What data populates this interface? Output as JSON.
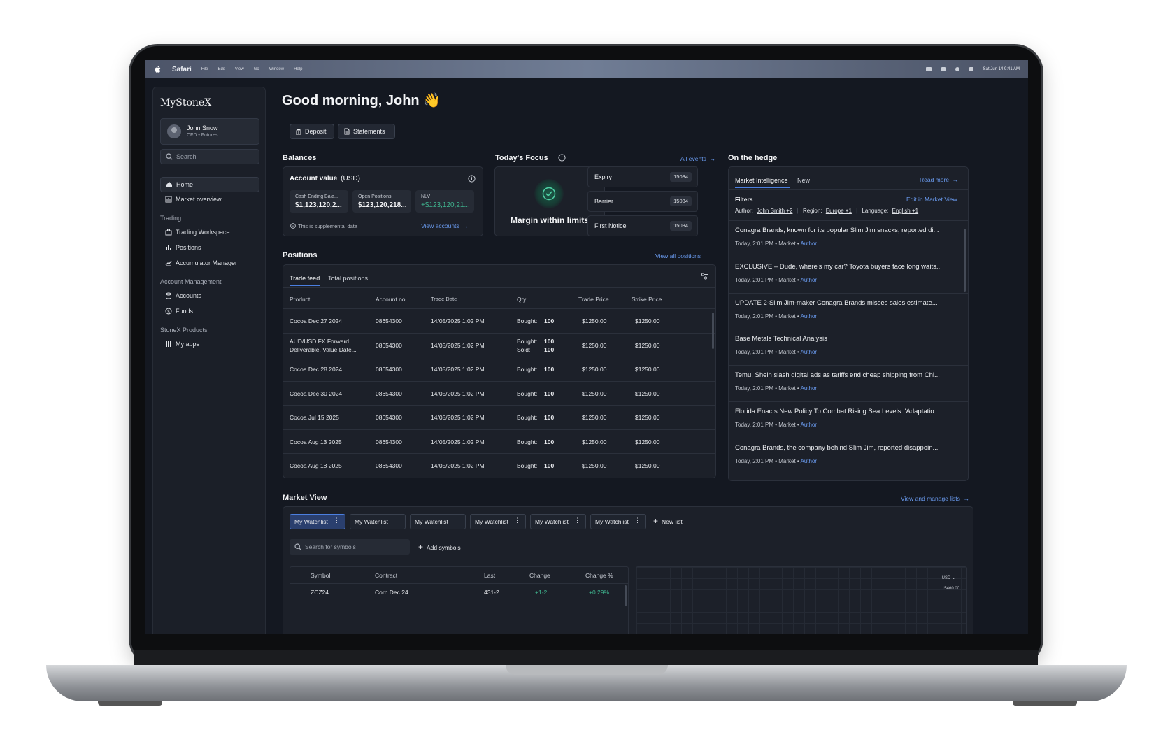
{
  "menubar": {
    "app_name": "Safari",
    "items": [
      "File",
      "Edit",
      "View",
      "Go",
      "Window",
      "Help"
    ],
    "status": "Sat Jun 14  9:41 AM"
  },
  "sidebar": {
    "logo": "MyStoneX",
    "user": {
      "name": "John Snow",
      "subtitle": "CFD • Futures"
    },
    "search_placeholder": "Search",
    "items_top": [
      {
        "label": "Home",
        "icon": "home-icon"
      },
      {
        "label": "Market overview",
        "icon": "chart-icon"
      }
    ],
    "sections": [
      {
        "title": "Trading",
        "items": [
          "Trading Workspace",
          "Positions",
          "Accumulator Manager"
        ]
      },
      {
        "title": "Account Management",
        "items": [
          "Accounts",
          "Funds"
        ]
      },
      {
        "title": "StoneX Products",
        "items": [
          "My apps"
        ]
      }
    ]
  },
  "header": {
    "greeting": "Good morning, John 👋",
    "deposit_label": "Deposit",
    "statements_label": "Statements"
  },
  "balances": {
    "title": "Balances",
    "card_title": "Account value",
    "currency": "(USD)",
    "stats": [
      {
        "label": "Cash Ending Bala...",
        "value": "$1,123,120,2..."
      },
      {
        "label": "Open Positions",
        "value": "$123,120,218..."
      },
      {
        "label": "NLV",
        "value": "+$123,120,21..."
      }
    ],
    "note": "This is supplemental data",
    "view_accounts": "View accounts"
  },
  "focus": {
    "title": "Today's Focus",
    "all_events": "All events",
    "status": "Margin within limits",
    "rows": [
      {
        "label": "Expiry",
        "value": "15034"
      },
      {
        "label": "Barrier",
        "value": "15034"
      },
      {
        "label": "First Notice",
        "value": "15034"
      }
    ]
  },
  "hedge": {
    "title": "On the hedge",
    "tabs": [
      "Market Intelligence",
      "New"
    ],
    "read_more": "Read more",
    "filters_label": "Filters",
    "edit_link": "Edit in Market View",
    "filters": [
      {
        "key": "Author:",
        "value": "John Smith +2"
      },
      {
        "key": "Region:",
        "value": "Europe +1"
      },
      {
        "key": "Language:",
        "value": "English +1"
      }
    ],
    "news": [
      {
        "title": "Conagra Brands, known for its popular Slim Jim snacks, reported di...",
        "meta": "Today, 2:01 PM • Market • ",
        "author": "Author"
      },
      {
        "title": "EXCLUSIVE – Dude, where's my car? Toyota buyers face long waits...",
        "meta": "Today, 2:01 PM • Market • ",
        "author": "Author"
      },
      {
        "title": "UPDATE 2-Slim Jim-maker Conagra Brands misses sales estimate...",
        "meta": "Today, 2:01 PM • Market • ",
        "author": "Author"
      },
      {
        "title": "Base Metals Technical Analysis",
        "meta": "Today, 2:01 PM • Market • ",
        "author": "Author"
      },
      {
        "title": "Temu, Shein slash digital ads as tariffs end cheap shipping from Chi...",
        "meta": "Today, 2:01 PM • Market • ",
        "author": "Author"
      },
      {
        "title": "Florida Enacts New Policy To Combat Rising Sea Levels: 'Adaptatio...",
        "meta": "Today, 2:01 PM • Market • ",
        "author": "Author"
      },
      {
        "title": "Conagra Brands, the company behind Slim Jim, reported disappoin...",
        "meta": "Today, 2:01 PM • Market • ",
        "author": "Author"
      }
    ]
  },
  "positions": {
    "title": "Positions",
    "view_all": "View all positions",
    "tabs": [
      "Trade feed",
      "Total positions"
    ],
    "columns": [
      "Product",
      "Account no.",
      "Trade Date",
      "Qty",
      "Trade Price",
      "Strike Price"
    ],
    "rows": [
      {
        "product": "Cocoa Dec 27 2024",
        "product2": "",
        "account": "08654300",
        "date": "14/05/2025 1:02 PM",
        "qty_label": "Bought:",
        "qty": "100",
        "qty_label2": "",
        "qty2": "",
        "trade_price": "$1250.00",
        "strike_price": "$1250.00"
      },
      {
        "product": "AUD/USD FX Forward",
        "product2": "Deliverable, Value Date...",
        "account": "08654300",
        "date": "14/05/2025 1:02 PM",
        "qty_label": "Bought:",
        "qty": "100",
        "qty_label2": "Sold:",
        "qty2": "100",
        "trade_price": "$1250.00",
        "strike_price": "$1250.00"
      },
      {
        "product": "Cocoa Dec 28 2024",
        "product2": "",
        "account": "08654300",
        "date": "14/05/2025 1:02 PM",
        "qty_label": "Bought:",
        "qty": "100",
        "qty_label2": "",
        "qty2": "",
        "trade_price": "$1250.00",
        "strike_price": "$1250.00"
      },
      {
        "product": "Cocoa Dec 30 2024",
        "product2": "",
        "account": "08654300",
        "date": "14/05/2025 1:02 PM",
        "qty_label": "Bought:",
        "qty": "100",
        "qty_label2": "",
        "qty2": "",
        "trade_price": "$1250.00",
        "strike_price": "$1250.00"
      },
      {
        "product": "Cocoa Jul 15 2025",
        "product2": "",
        "account": "08654300",
        "date": "14/05/2025 1:02 PM",
        "qty_label": "Bought:",
        "qty": "100",
        "qty_label2": "",
        "qty2": "",
        "trade_price": "$1250.00",
        "strike_price": "$1250.00"
      },
      {
        "product": "Cocoa Aug 13 2025",
        "product2": "",
        "account": "08654300",
        "date": "14/05/2025 1:02 PM",
        "qty_label": "Bought:",
        "qty": "100",
        "qty_label2": "",
        "qty2": "",
        "trade_price": "$1250.00",
        "strike_price": "$1250.00"
      },
      {
        "product": "Cocoa Aug 18 2025",
        "product2": "",
        "account": "08654300",
        "date": "14/05/2025 1:02 PM",
        "qty_label": "Bought:",
        "qty": "100",
        "qty_label2": "",
        "qty2": "",
        "trade_price": "$1250.00",
        "strike_price": "$1250.00"
      }
    ]
  },
  "market_view": {
    "title": "Market View",
    "manage_link": "View and manage lists",
    "watchlists": [
      "My Watchlist",
      "My Watchlist",
      "My Watchlist",
      "My Watchlist",
      "My Watchlist",
      "My Watchlist"
    ],
    "new_list": "New list",
    "search_placeholder": "Search for symbols",
    "add_symbols": "Add symbols",
    "columns": [
      "Symbol",
      "Contract",
      "Last",
      "Change",
      "Change %"
    ],
    "rows": [
      {
        "symbol": "ZCZ24",
        "contract": "Corn Dec 24",
        "last": "431-2",
        "change": "+1-2",
        "change_pct": "+0.29%"
      }
    ],
    "chart_currency": "USD ⌄",
    "chart_price": "15460.00"
  },
  "colors": {
    "accent": "#4b7fe0",
    "positive": "#3fb58f",
    "background": "#141821"
  }
}
